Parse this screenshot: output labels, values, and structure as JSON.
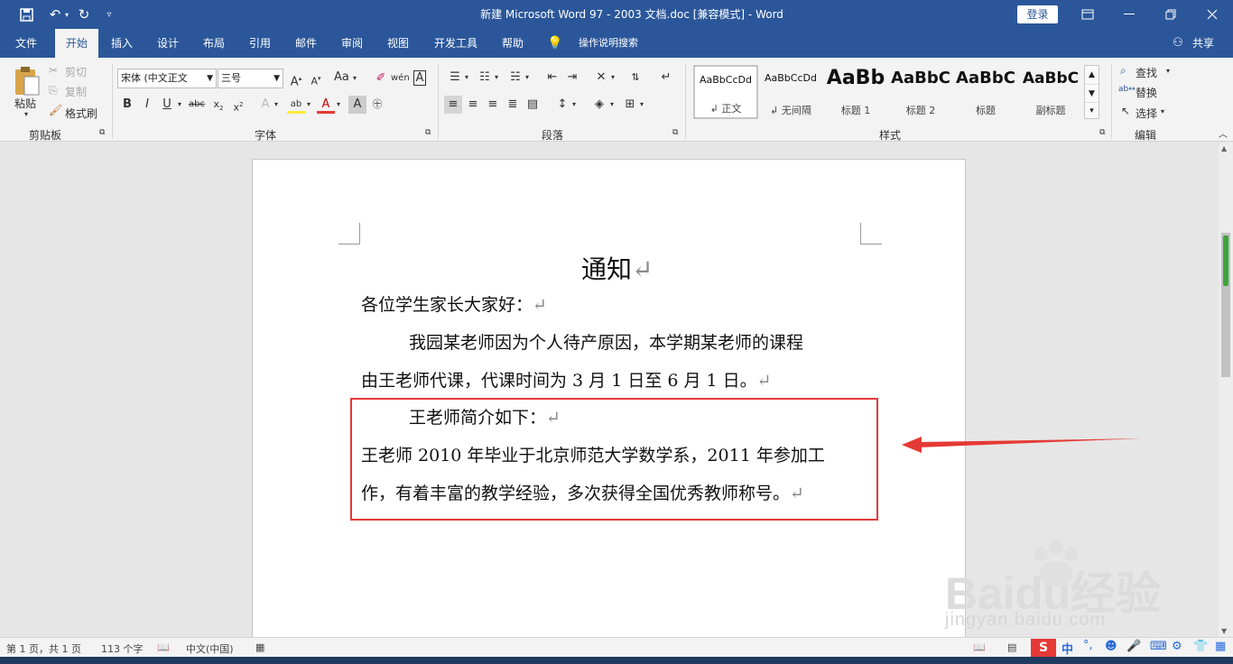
{
  "window": {
    "title": "新建 Microsoft Word 97 - 2003 文档.doc [兼容模式] - Word",
    "login_label": "登录",
    "quick_access": [
      "save-icon",
      "undo-icon",
      "redo-icon",
      "customize-icon"
    ]
  },
  "tabs": [
    {
      "label": "文件"
    },
    {
      "label": "开始"
    },
    {
      "label": "插入"
    },
    {
      "label": "设计"
    },
    {
      "label": "布局"
    },
    {
      "label": "引用"
    },
    {
      "label": "邮件"
    },
    {
      "label": "审阅"
    },
    {
      "label": "视图"
    },
    {
      "label": "开发工具"
    },
    {
      "label": "帮助"
    }
  ],
  "tell_me": "操作说明搜索",
  "share_label": "共享",
  "ribbon": {
    "clipboard": {
      "label": "剪贴板",
      "paste": "粘贴",
      "cut": "剪切",
      "copy": "复制",
      "format_painter": "格式刷"
    },
    "font": {
      "label": "字体",
      "font_name": "宋体 (中文正文",
      "font_size": "三号",
      "change_case": "Aa"
    },
    "paragraph": {
      "label": "段落"
    },
    "styles": {
      "label": "样式",
      "items": [
        {
          "sample": "AaBbCcDd",
          "name": "↲ 正文"
        },
        {
          "sample": "AaBbCcDd",
          "name": "↲ 无间隔"
        },
        {
          "sample": "AaBb",
          "name": "标题 1"
        },
        {
          "sample": "AaBbC",
          "name": "标题 2"
        },
        {
          "sample": "AaBbC",
          "name": "标题"
        },
        {
          "sample": "AaBbC",
          "name": "副标题"
        }
      ]
    },
    "editing": {
      "label": "编辑",
      "find": "查找",
      "replace": "替换",
      "select": "选择"
    }
  },
  "document": {
    "title": "通知",
    "greeting": "各位学生家长大家好：",
    "p1_line1": "我园某老师因为个人待产原因，本学期某老师的课程",
    "p1_line2": "由王老师代课，代课时间为 3 月 1 日至 6 月 1 日。",
    "p2": "王老师简介如下：",
    "p3_line1": "王老师 2010 年毕业于北京师范大学数学系，2011 年参加工",
    "p3_line2": "作，有着丰富的教学经验，多次获得全国优秀教师称号。",
    "paragraph_mark": "↵"
  },
  "status": {
    "page": "第 1 页，共 1 页",
    "words": "113 个字",
    "language": "中文(中国)"
  },
  "ime": {
    "label": "中"
  },
  "watermark": {
    "line1": "Baidu经验",
    "line2": "jingyan.baidu.com"
  },
  "colors": {
    "accent": "#2b579a",
    "highlight_box": "#e53935"
  }
}
